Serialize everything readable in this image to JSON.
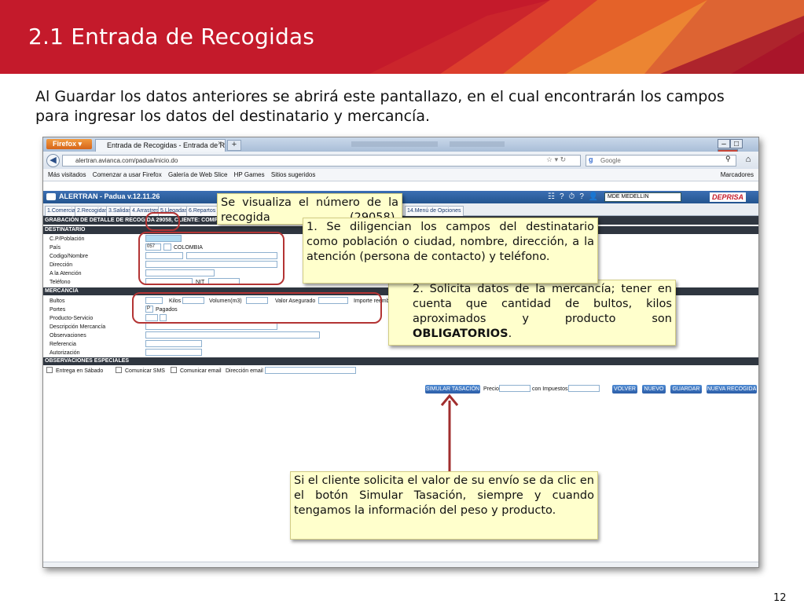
{
  "slide": {
    "title": "2.1 Entrada de Recogidas",
    "intro": "Al Guardar los datos anteriores se abrirá este pantallazo, en el cual encontrarán los campos para ingresar los datos del destinatario y mercancía.",
    "page_number": "12",
    "colors": {
      "header_red": "#c41a2b",
      "callout_bg": "#ffffcc",
      "oval": "#b33434"
    }
  },
  "browser": {
    "menu_button": "Firefox",
    "tab_title": "Entrada de Recogidas - Entrada de Reco...",
    "tab_close": "×",
    "new_tab": "+",
    "url": "alertran.avianca.com/padua/inicio.do",
    "search_placeholder": "Google",
    "bookmarks": [
      "Más visitados",
      "Comenzar a usar Firefox",
      "Galería de Web Slice",
      "HP Games",
      "Sitios sugeridos"
    ],
    "bookmarks_menu": "Marcadores",
    "icons": [
      "back-arrow-icon",
      "star-icon",
      "reload-icon",
      "search-icon",
      "home-icon"
    ]
  },
  "app": {
    "title": "ALERTRAN - Padua  v.12.11.26",
    "office": "MDE MEDELLIN",
    "brand": "DEPRISA",
    "menu_tabs": [
      "1.Comercial",
      "2.Recogidas",
      "3.Salidas",
      "4.Arrastres",
      "5.Llegadas",
      "6.Repartos",
      "14.Menú de Opciones"
    ],
    "banner": "GRABACIÓN DE DETALLE DE RECOGIDA 29058, CLIENTE: COMP",
    "sections": {
      "destinatario": "DESTINATARIO",
      "mercancia": "MERCANCÍA",
      "observaciones": "OBSERVACIONES ESPECIALES"
    },
    "dest_labels": [
      "C.P/Población",
      "País",
      "Codigo/Nombre",
      "Dirección",
      "A la Atención",
      "Teléfono"
    ],
    "pais_code": "057",
    "pais_name": "COLOMBIA",
    "nit_label": "NIT",
    "merc_labels": [
      "Bultos",
      "Portes",
      "Producto-Servicio",
      "Descripción Mercancía",
      "Observaciones",
      "Referencia",
      "Autorización"
    ],
    "kilos_label": "Kilos",
    "volumen_label": "Volumen(m3)",
    "valor_label": "Valor Asegurado",
    "importe_label": "Importe reemb",
    "portes_code": "P",
    "portes_value": "Pagados",
    "obs_checks": [
      "Entrega en Sábado",
      "Comunicar SMS",
      "Comunicar email"
    ],
    "email_label": "Dirección email",
    "simular_button": "SIMULAR TASACIÓN",
    "precio_label": "Precio",
    "impuestos_label": "con Impuestos",
    "buttons": {
      "volver": "VOLVER",
      "nuevo": "NUEVO",
      "guardar": "GUARDAR",
      "nueva": "NUEVA RECOGIDA"
    }
  },
  "callouts": {
    "numero": "Se visualiza el número de la recogida (29058).",
    "destinatario": "1. Se diligencian los campos del destinatario como población o ciudad, nombre, dirección, a la atención (persona de contacto) y teléfono.",
    "mercancia": "2. Solicita datos de la mercancía; tener en cuenta que cantidad de bultos, kilos aproximados y producto son",
    "mercancia_bold": "OBLIGATORIOS",
    "mercancia_end": ".",
    "simular": "Si el cliente solicita el valor de su envío se da clic en el botón Simular Tasación, siempre y cuando tengamos la información del peso y producto."
  }
}
